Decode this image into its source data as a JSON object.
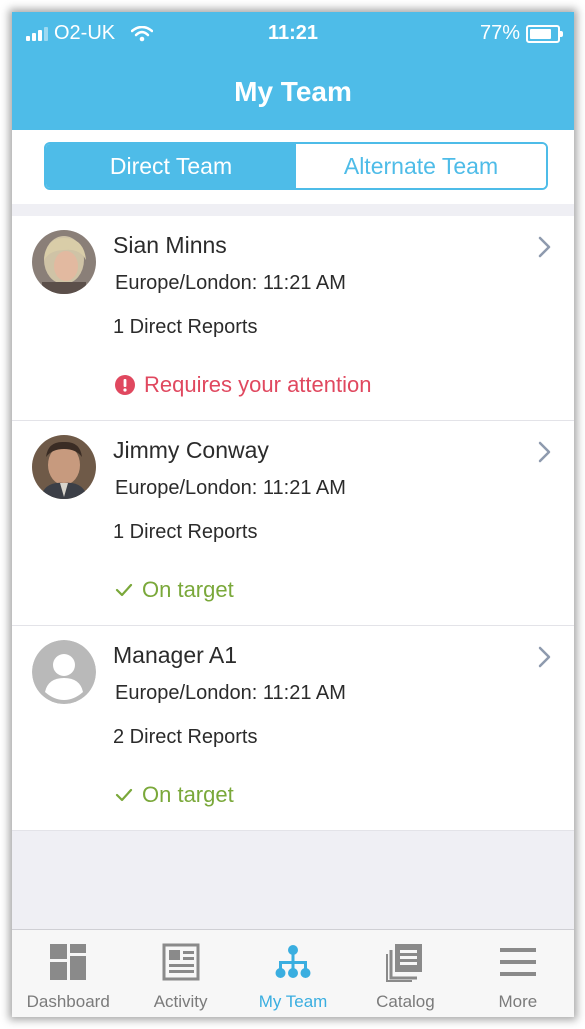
{
  "status_bar": {
    "carrier": "O2-UK",
    "time": "11:21",
    "battery": "77%"
  },
  "header": {
    "title": "My Team"
  },
  "segments": [
    {
      "label": "Direct Team",
      "active": true
    },
    {
      "label": "Alternate Team",
      "active": false
    }
  ],
  "team": [
    {
      "name": "Sian Minns",
      "timezone": "Europe/London: 11:21 AM",
      "reports": "1 Direct Reports",
      "status": "Requires your attention",
      "status_kind": "attention"
    },
    {
      "name": "Jimmy Conway",
      "timezone": "Europe/London: 11:21 AM",
      "reports": "1 Direct Reports",
      "status": "On target",
      "status_kind": "ok"
    },
    {
      "name": "Manager A1",
      "timezone": "Europe/London: 11:21 AM",
      "reports": "2 Direct Reports",
      "status": "On target",
      "status_kind": "ok"
    }
  ],
  "tabs": [
    {
      "label": "Dashboard",
      "icon": "dashboard-icon",
      "active": false
    },
    {
      "label": "Activity",
      "icon": "activity-icon",
      "active": false
    },
    {
      "label": "My Team",
      "icon": "org-chart-icon",
      "active": true
    },
    {
      "label": "Catalog",
      "icon": "catalog-icon",
      "active": false
    },
    {
      "label": "More",
      "icon": "menu-icon",
      "active": false
    }
  ],
  "colors": {
    "header": "#4ebce8",
    "attention": "#e0485f",
    "ok": "#7aa83a",
    "active_tab": "#3aaee0"
  }
}
